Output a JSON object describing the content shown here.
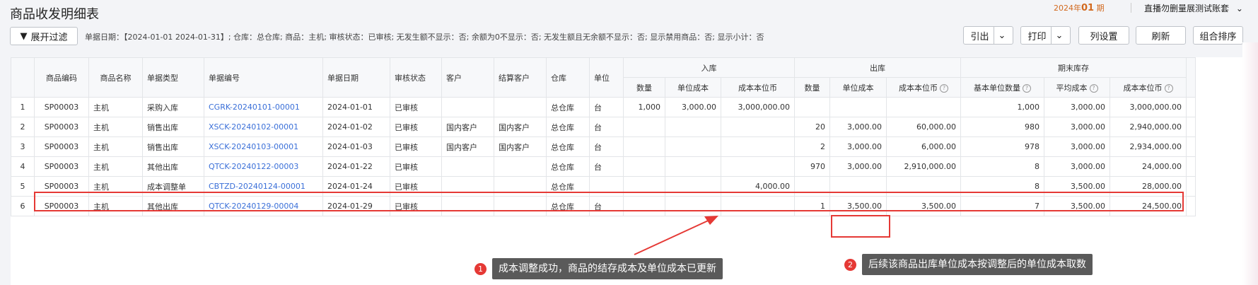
{
  "page": {
    "title": "商品收发明细表",
    "period_prefix": "2024年",
    "period_month": "01",
    "period_suffix": " 期",
    "account_name": "直播勿删量展测试账套"
  },
  "toolbar": {
    "expand_filter": "展开过滤",
    "filter_info": "单据日期：【2024-01-01 2024-01-31】; 仓库：总仓库; 商品：主机; 审核状态：已审核; 无发生额不显示：否; 余额为0不显示：否; 无发生额且无余额不显示：否; 显示禁用商品：否; 显示小计：否",
    "export": "引出",
    "print": "打印",
    "column_settings": "列设置",
    "refresh": "刷新",
    "combo_sort": "组合排序"
  },
  "table": {
    "group_in": "入库",
    "group_out": "出库",
    "group_end": "期末库存",
    "headers": {
      "product_code": "商品编码",
      "product_name": "商品名称",
      "doc_type": "单据类型",
      "doc_no": "单据编号",
      "doc_date": "单据日期",
      "audit_status": "审核状态",
      "customer": "客户",
      "settle_customer": "结算客户",
      "warehouse": "仓库",
      "unit": "单位",
      "in_qty": "数量",
      "in_unit_cost": "单位成本",
      "in_cost": "成本本位币",
      "out_qty": "数量",
      "out_unit_cost": "单位成本",
      "out_cost": "成本本位币",
      "end_qty": "基本单位数量",
      "end_avg_cost": "平均成本",
      "end_cost": "成本本位币"
    },
    "rows": [
      {
        "n": "1",
        "code": "SP00003",
        "name": "主机",
        "type": "采购入库",
        "no": "CGRK-20240101-00001",
        "date": "2024-01-01",
        "status": "已审核",
        "cust": "",
        "settle": "",
        "wh": "总仓库",
        "unit": "台",
        "in_qty": "1,000",
        "in_uc": "3,000.00",
        "in_cost": "3,000,000.00",
        "out_qty": "",
        "out_uc": "",
        "out_cost": "",
        "end_qty": "1,000",
        "end_avg": "3,000.00",
        "end_cost": "3,000,000.00"
      },
      {
        "n": "2",
        "code": "SP00003",
        "name": "主机",
        "type": "销售出库",
        "no": "XSCK-20240102-00001",
        "date": "2024-01-02",
        "status": "已审核",
        "cust": "国内客户",
        "settle": "国内客户",
        "wh": "总仓库",
        "unit": "台",
        "in_qty": "",
        "in_uc": "",
        "in_cost": "",
        "out_qty": "20",
        "out_uc": "3,000.00",
        "out_cost": "60,000.00",
        "end_qty": "980",
        "end_avg": "3,000.00",
        "end_cost": "2,940,000.00"
      },
      {
        "n": "3",
        "code": "SP00003",
        "name": "主机",
        "type": "销售出库",
        "no": "XSCK-20240103-00001",
        "date": "2024-01-03",
        "status": "已审核",
        "cust": "国内客户",
        "settle": "国内客户",
        "wh": "总仓库",
        "unit": "台",
        "in_qty": "",
        "in_uc": "",
        "in_cost": "",
        "out_qty": "2",
        "out_uc": "3,000.00",
        "out_cost": "6,000.00",
        "end_qty": "978",
        "end_avg": "3,000.00",
        "end_cost": "2,934,000.00"
      },
      {
        "n": "4",
        "code": "SP00003",
        "name": "主机",
        "type": "其他出库",
        "no": "QTCK-20240122-00003",
        "date": "2024-01-22",
        "status": "已审核",
        "cust": "",
        "settle": "",
        "wh": "总仓库",
        "unit": "台",
        "in_qty": "",
        "in_uc": "",
        "in_cost": "",
        "out_qty": "970",
        "out_uc": "3,000.00",
        "out_cost": "2,910,000.00",
        "end_qty": "8",
        "end_avg": "3,000.00",
        "end_cost": "24,000.00"
      },
      {
        "n": "5",
        "code": "SP00003",
        "name": "主机",
        "type": "成本调整单",
        "no": "CBTZD-20240124-00001",
        "date": "2024-01-24",
        "status": "已审核",
        "cust": "",
        "settle": "",
        "wh": "总仓库",
        "unit": "",
        "in_qty": "",
        "in_uc": "",
        "in_cost": "4,000.00",
        "out_qty": "",
        "out_uc": "",
        "out_cost": "",
        "end_qty": "8",
        "end_avg": "3,500.00",
        "end_cost": "28,000.00"
      },
      {
        "n": "6",
        "code": "SP00003",
        "name": "主机",
        "type": "其他出库",
        "no": "QTCK-20240129-00004",
        "date": "2024-01-29",
        "status": "已审核",
        "cust": "",
        "settle": "",
        "wh": "总仓库",
        "unit": "台",
        "in_qty": "",
        "in_uc": "",
        "in_cost": "",
        "out_qty": "1",
        "out_uc": "3,500.00",
        "out_cost": "3,500.00",
        "end_qty": "7",
        "end_avg": "3,500.00",
        "end_cost": "24,500.00"
      }
    ]
  },
  "annotations": {
    "badge1": "1",
    "tip1": "成本调整成功，商品的结存成本及单位成本已更新",
    "badge2": "2",
    "tip2": "后续该商品出库单位成本按调整后的单位成本取数"
  },
  "colors": {
    "highlight": "#e53935",
    "link": "#3a6fd8",
    "period": "#d2691e"
  }
}
